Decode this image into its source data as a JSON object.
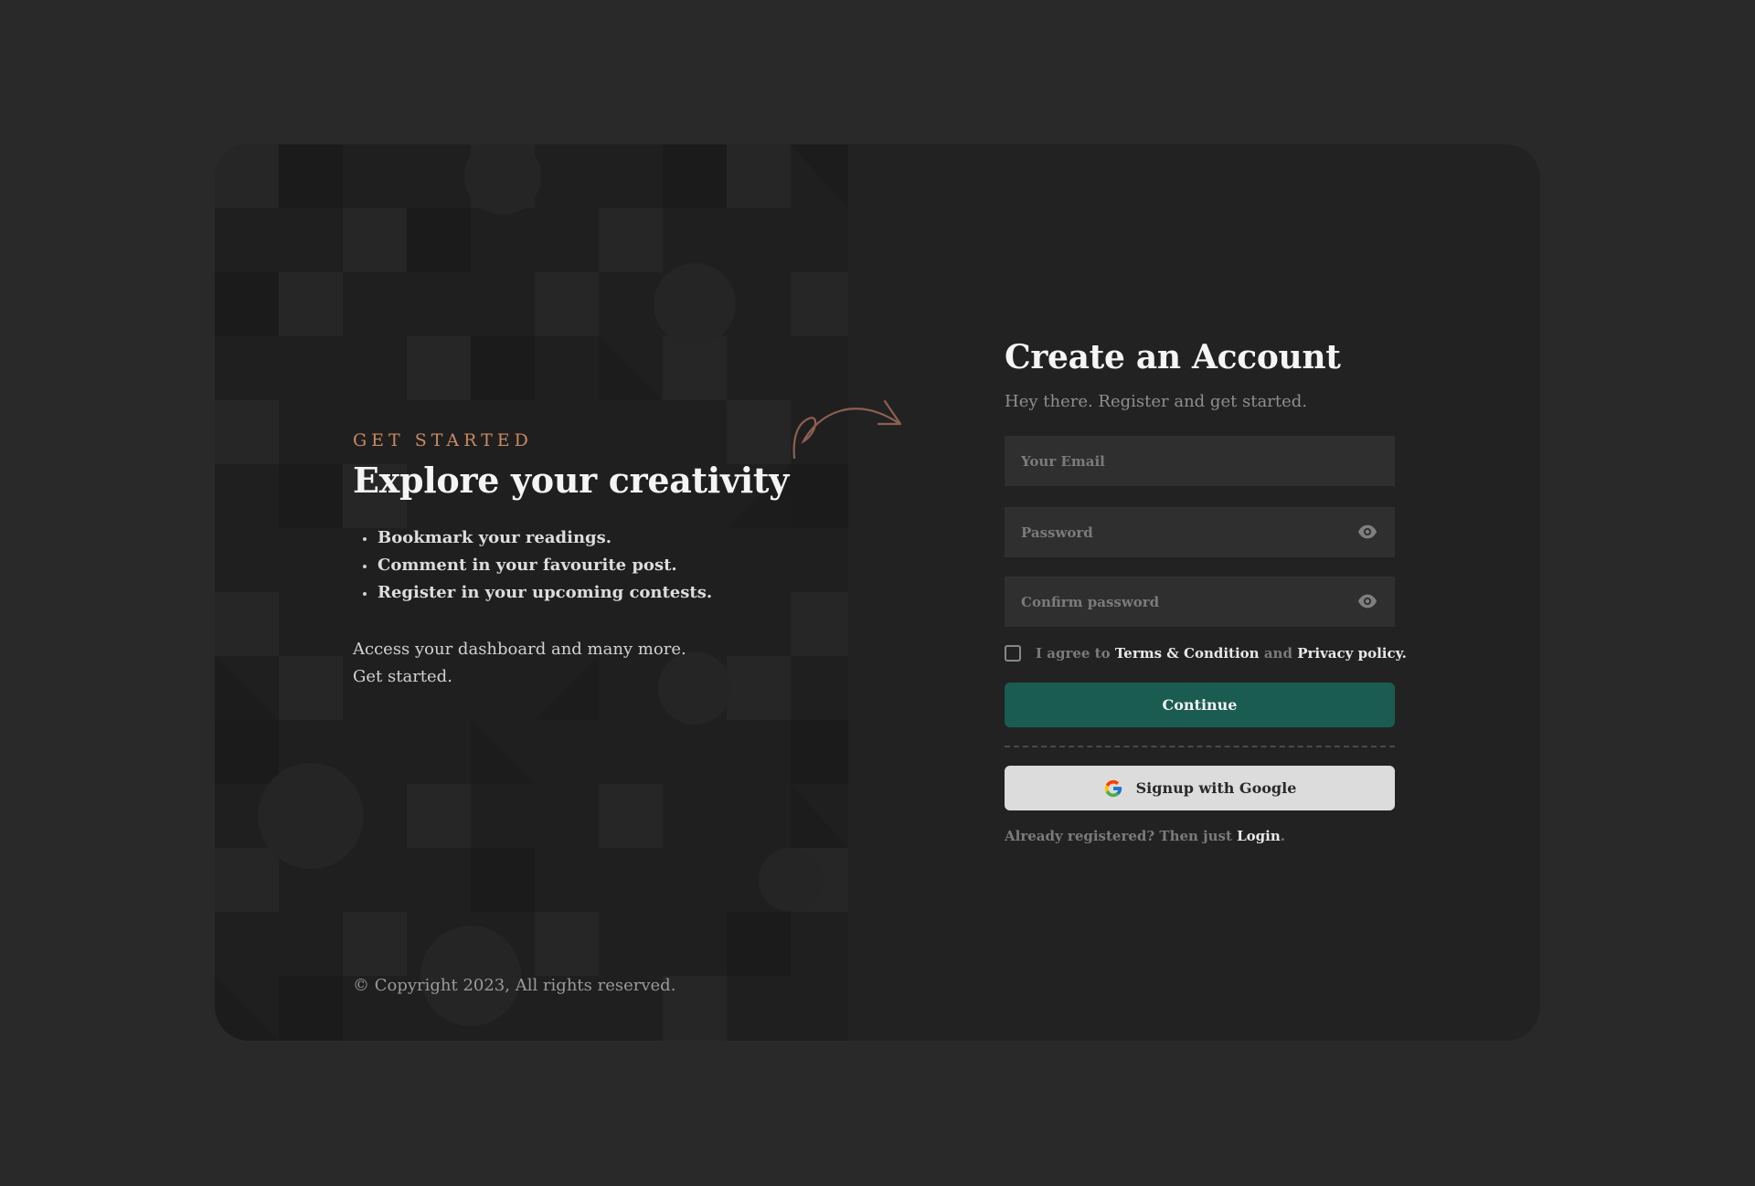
{
  "hero": {
    "eyebrow": "GET STARTED",
    "title": "Explore your creativity",
    "features": [
      "Bookmark your readings.",
      "Comment in your favourite post.",
      "Register in your upcoming contests."
    ],
    "access_line1": "Access your dashboard and many more.",
    "access_line2": "Get started.",
    "copyright": "© Copyright 2023, All rights reserved."
  },
  "form": {
    "title": "Create an Account",
    "subtitle": "Hey there. Register and get started.",
    "email_placeholder": "Your Email",
    "password_placeholder": "Password",
    "confirm_placeholder": "Confirm password",
    "agree_prefix": "I agree to",
    "terms_link": "Terms & Condition",
    "agree_and": "and",
    "privacy_link": "Privacy policy.",
    "continue_label": "Continue",
    "google_label": "Signup with Google",
    "login_prefix": "Already registered? Then just",
    "login_link": "Login",
    "login_suffix": "."
  },
  "icons": {
    "password_toggle": "eye-icon",
    "confirm_toggle": "eye-icon",
    "google": "google-logo-icon",
    "decor": "curved-arrow-icon"
  },
  "colors": {
    "background": "#292929",
    "card": "#222222",
    "accent": "#c98a62",
    "primary_button": "#1b5c52",
    "google_button": "#dcdcdc"
  }
}
